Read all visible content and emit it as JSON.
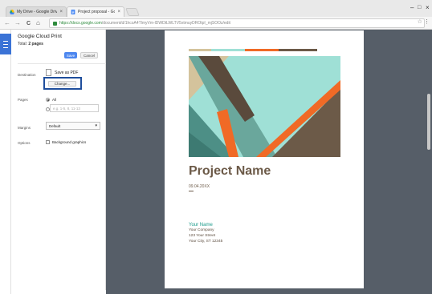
{
  "tabs": [
    {
      "label": "My Drive - Google Drive",
      "close": "×"
    },
    {
      "label": "Project proposal - Goo",
      "close": "×"
    }
  ],
  "window": {
    "minimize": "–",
    "maximize": "□",
    "close": "×"
  },
  "nav": {
    "back": "←",
    "forward": "→",
    "reload": "C",
    "home": "⌂"
  },
  "address": {
    "secure": "https://docs.google.com",
    "path": "/document/d/1hcoA4TlmyVm-lDWDtLWLTV5xtmuyDROtpI_mjSOOz/edit",
    "star": "☆",
    "menu": "⋮"
  },
  "print": {
    "title": "Google Cloud Print",
    "total_label": "Total:",
    "total_value": "2 pages",
    "save_label": "Save",
    "cancel_label": "Cancel",
    "destination_label": "Destination",
    "destination_value": "Save as PDF",
    "change_label": "Change...",
    "pages_label": "Pages",
    "pages_all": "All",
    "pages_placeholder": "e.g. 1-5, 8, 11-13",
    "margins_label": "Margins",
    "margins_value": "Default",
    "options_label": "Options",
    "background_graphics": "Background graphics"
  },
  "document": {
    "title": "Project Name",
    "date": "09.04.20XX",
    "your_name": "Your Name",
    "address_lines": [
      "Your Company",
      "123 Your Street",
      "Your City, ST 12345"
    ]
  },
  "colors": {
    "accent_blue": "#4d87ef",
    "teal": "#9fe0d6",
    "orange": "#f06a26",
    "brown": "#6c5a48",
    "tan": "#d4c39c",
    "preview_bg": "#565e68"
  }
}
